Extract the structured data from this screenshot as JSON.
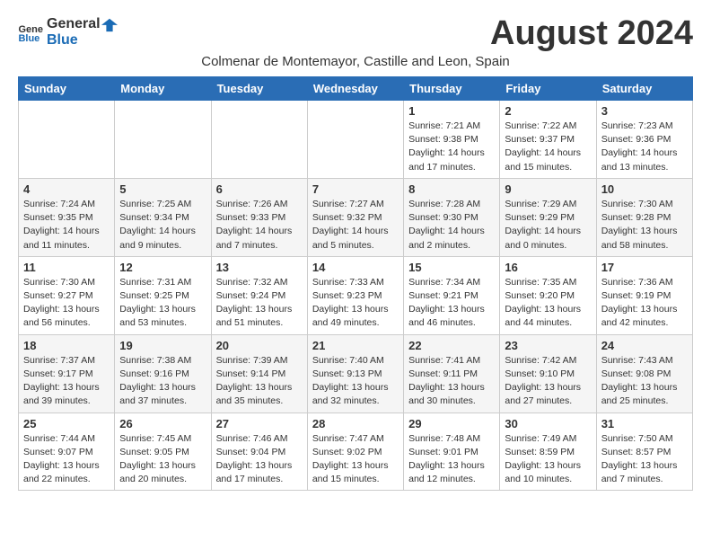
{
  "logo": {
    "text_general": "General",
    "text_blue": "Blue"
  },
  "header": {
    "month_title": "August 2024",
    "subtitle": "Colmenar de Montemayor, Castille and Leon, Spain"
  },
  "weekdays": [
    "Sunday",
    "Monday",
    "Tuesday",
    "Wednesday",
    "Thursday",
    "Friday",
    "Saturday"
  ],
  "weeks": [
    {
      "id": "week1",
      "days": [
        {
          "num": "",
          "info": ""
        },
        {
          "num": "",
          "info": ""
        },
        {
          "num": "",
          "info": ""
        },
        {
          "num": "",
          "info": ""
        },
        {
          "num": "1",
          "info": "Sunrise: 7:21 AM\nSunset: 9:38 PM\nDaylight: 14 hours\nand 17 minutes."
        },
        {
          "num": "2",
          "info": "Sunrise: 7:22 AM\nSunset: 9:37 PM\nDaylight: 14 hours\nand 15 minutes."
        },
        {
          "num": "3",
          "info": "Sunrise: 7:23 AM\nSunset: 9:36 PM\nDaylight: 14 hours\nand 13 minutes."
        }
      ]
    },
    {
      "id": "week2",
      "days": [
        {
          "num": "4",
          "info": "Sunrise: 7:24 AM\nSunset: 9:35 PM\nDaylight: 14 hours\nand 11 minutes."
        },
        {
          "num": "5",
          "info": "Sunrise: 7:25 AM\nSunset: 9:34 PM\nDaylight: 14 hours\nand 9 minutes."
        },
        {
          "num": "6",
          "info": "Sunrise: 7:26 AM\nSunset: 9:33 PM\nDaylight: 14 hours\nand 7 minutes."
        },
        {
          "num": "7",
          "info": "Sunrise: 7:27 AM\nSunset: 9:32 PM\nDaylight: 14 hours\nand 5 minutes."
        },
        {
          "num": "8",
          "info": "Sunrise: 7:28 AM\nSunset: 9:30 PM\nDaylight: 14 hours\nand 2 minutes."
        },
        {
          "num": "9",
          "info": "Sunrise: 7:29 AM\nSunset: 9:29 PM\nDaylight: 14 hours\nand 0 minutes."
        },
        {
          "num": "10",
          "info": "Sunrise: 7:30 AM\nSunset: 9:28 PM\nDaylight: 13 hours\nand 58 minutes."
        }
      ]
    },
    {
      "id": "week3",
      "days": [
        {
          "num": "11",
          "info": "Sunrise: 7:30 AM\nSunset: 9:27 PM\nDaylight: 13 hours\nand 56 minutes."
        },
        {
          "num": "12",
          "info": "Sunrise: 7:31 AM\nSunset: 9:25 PM\nDaylight: 13 hours\nand 53 minutes."
        },
        {
          "num": "13",
          "info": "Sunrise: 7:32 AM\nSunset: 9:24 PM\nDaylight: 13 hours\nand 51 minutes."
        },
        {
          "num": "14",
          "info": "Sunrise: 7:33 AM\nSunset: 9:23 PM\nDaylight: 13 hours\nand 49 minutes."
        },
        {
          "num": "15",
          "info": "Sunrise: 7:34 AM\nSunset: 9:21 PM\nDaylight: 13 hours\nand 46 minutes."
        },
        {
          "num": "16",
          "info": "Sunrise: 7:35 AM\nSunset: 9:20 PM\nDaylight: 13 hours\nand 44 minutes."
        },
        {
          "num": "17",
          "info": "Sunrise: 7:36 AM\nSunset: 9:19 PM\nDaylight: 13 hours\nand 42 minutes."
        }
      ]
    },
    {
      "id": "week4",
      "days": [
        {
          "num": "18",
          "info": "Sunrise: 7:37 AM\nSunset: 9:17 PM\nDaylight: 13 hours\nand 39 minutes."
        },
        {
          "num": "19",
          "info": "Sunrise: 7:38 AM\nSunset: 9:16 PM\nDaylight: 13 hours\nand 37 minutes."
        },
        {
          "num": "20",
          "info": "Sunrise: 7:39 AM\nSunset: 9:14 PM\nDaylight: 13 hours\nand 35 minutes."
        },
        {
          "num": "21",
          "info": "Sunrise: 7:40 AM\nSunset: 9:13 PM\nDaylight: 13 hours\nand 32 minutes."
        },
        {
          "num": "22",
          "info": "Sunrise: 7:41 AM\nSunset: 9:11 PM\nDaylight: 13 hours\nand 30 minutes."
        },
        {
          "num": "23",
          "info": "Sunrise: 7:42 AM\nSunset: 9:10 PM\nDaylight: 13 hours\nand 27 minutes."
        },
        {
          "num": "24",
          "info": "Sunrise: 7:43 AM\nSunset: 9:08 PM\nDaylight: 13 hours\nand 25 minutes."
        }
      ]
    },
    {
      "id": "week5",
      "days": [
        {
          "num": "25",
          "info": "Sunrise: 7:44 AM\nSunset: 9:07 PM\nDaylight: 13 hours\nand 22 minutes."
        },
        {
          "num": "26",
          "info": "Sunrise: 7:45 AM\nSunset: 9:05 PM\nDaylight: 13 hours\nand 20 minutes."
        },
        {
          "num": "27",
          "info": "Sunrise: 7:46 AM\nSunset: 9:04 PM\nDaylight: 13 hours\nand 17 minutes."
        },
        {
          "num": "28",
          "info": "Sunrise: 7:47 AM\nSunset: 9:02 PM\nDaylight: 13 hours\nand 15 minutes."
        },
        {
          "num": "29",
          "info": "Sunrise: 7:48 AM\nSunset: 9:01 PM\nDaylight: 13 hours\nand 12 minutes."
        },
        {
          "num": "30",
          "info": "Sunrise: 7:49 AM\nSunset: 8:59 PM\nDaylight: 13 hours\nand 10 minutes."
        },
        {
          "num": "31",
          "info": "Sunrise: 7:50 AM\nSunset: 8:57 PM\nDaylight: 13 hours\nand 7 minutes."
        }
      ]
    }
  ]
}
